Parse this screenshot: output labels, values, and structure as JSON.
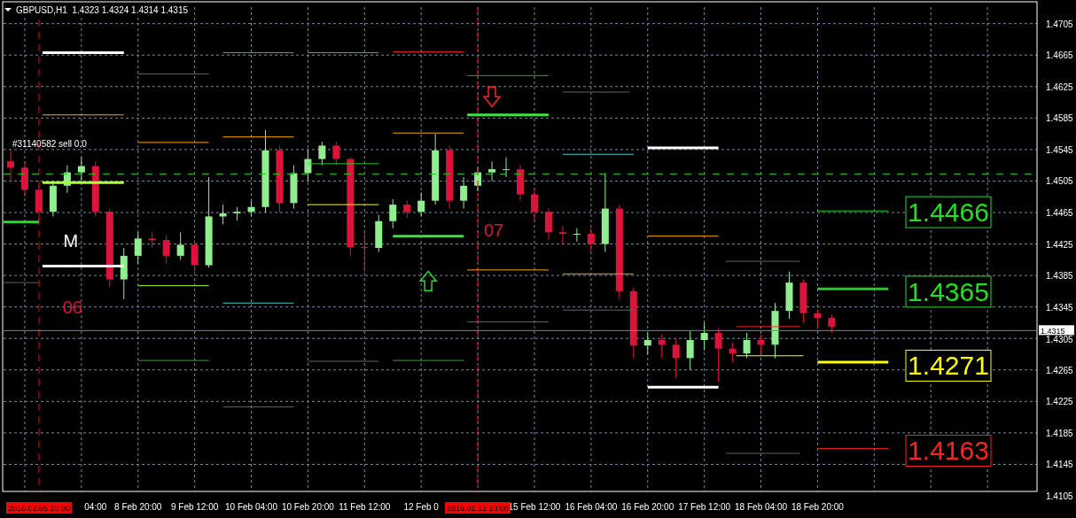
{
  "chart": {
    "title": "GBPUSD,H1",
    "quote": "1.4323 1.4324 1.4314 1.4315",
    "chart_data": {
      "type": "candlestick",
      "grid": true,
      "categories": [
        null,
        null,
        null,
        null,
        null,
        null,
        "04:00",
        null,
        null,
        "8 Feb 20:00",
        null,
        null,
        null,
        "9 Feb 12:00",
        null,
        null,
        null,
        "10 Feb 04:00",
        null,
        null,
        null,
        "10 Feb 20:00",
        null,
        null,
        null,
        "11 Feb 12:00",
        null,
        null,
        null,
        "12 Feb 0",
        null,
        null,
        null,
        null,
        null,
        null,
        null,
        "15 Feb 12:00",
        null,
        null,
        null,
        "16 Feb 04:00",
        null,
        null,
        null,
        "16 Feb 20:00",
        null,
        null,
        null,
        "17 Feb 12:00",
        null,
        null,
        null,
        "18 Feb 04:00",
        null,
        null,
        null,
        "18 Feb 20:00",
        null,
        null,
        null,
        null,
        null,
        null,
        null,
        null,
        null,
        null,
        null,
        null,
        null,
        null,
        null
      ],
      "ohlc": [
        [
          1.453,
          1.4545,
          1.4505,
          1.4522
        ],
        [
          1.4522,
          1.453,
          1.4485,
          1.4494
        ],
        [
          1.4494,
          1.45,
          1.4455,
          1.4466
        ],
        [
          1.4466,
          1.4505,
          1.446,
          1.4499
        ],
        [
          1.4499,
          1.4525,
          1.449,
          1.4516
        ],
        [
          1.4516,
          1.4535,
          1.4505,
          1.4524
        ],
        [
          1.4524,
          1.453,
          1.446,
          1.4466
        ],
        [
          1.4466,
          1.447,
          1.437,
          1.438
        ],
        [
          1.438,
          1.442,
          1.4355,
          1.441
        ],
        [
          1.441,
          1.444,
          1.44,
          1.4432
        ],
        [
          1.4432,
          1.444,
          1.442,
          1.443
        ],
        [
          1.443,
          1.4436,
          1.44,
          1.441
        ],
        [
          1.441,
          1.444,
          1.4405,
          1.4424
        ],
        [
          1.4424,
          1.443,
          1.4385,
          1.4398
        ],
        [
          1.4398,
          1.451,
          1.4395,
          1.446
        ],
        [
          1.446,
          1.4475,
          1.445,
          1.4464
        ],
        [
          1.4464,
          1.4472,
          1.4455,
          1.4466
        ],
        [
          1.4466,
          1.448,
          1.446,
          1.4472
        ],
        [
          1.4472,
          1.457,
          1.4465,
          1.4544
        ],
        [
          1.4544,
          1.455,
          1.4465,
          1.4477
        ],
        [
          1.4477,
          1.4525,
          1.447,
          1.4515
        ],
        [
          1.4515,
          1.4545,
          1.4505,
          1.4533
        ],
        [
          1.4533,
          1.4555,
          1.4525,
          1.455
        ],
        [
          1.455,
          1.4555,
          1.4525,
          1.4533
        ],
        [
          1.4533,
          1.4535,
          1.441,
          1.4421
        ],
        [
          1.4421,
          1.444,
          1.439,
          1.442
        ],
        [
          1.442,
          1.4462,
          1.4415,
          1.4454
        ],
        [
          1.4454,
          1.4482,
          1.4445,
          1.4475
        ],
        [
          1.4475,
          1.448,
          1.4458,
          1.4466
        ],
        [
          1.4466,
          1.449,
          1.446,
          1.448
        ],
        [
          1.448,
          1.4565,
          1.4475,
          1.4544
        ],
        [
          1.4544,
          1.455,
          1.447,
          1.448
        ],
        [
          1.448,
          1.451,
          1.447,
          1.4499
        ],
        [
          1.4499,
          1.4522,
          1.4492,
          1.4516
        ],
        [
          1.4516,
          1.453,
          1.4505,
          1.452
        ],
        [
          1.452,
          1.4535,
          1.451,
          1.452
        ],
        [
          1.452,
          1.4525,
          1.448,
          1.4488
        ],
        [
          1.4488,
          1.4495,
          1.4455,
          1.4466
        ],
        [
          1.4466,
          1.447,
          1.443,
          1.444
        ],
        [
          1.444,
          1.4448,
          1.4425,
          1.4438
        ],
        [
          1.4438,
          1.4445,
          1.4428,
          1.4438
        ],
        [
          1.4438,
          1.4445,
          1.4415,
          1.4425
        ],
        [
          1.4425,
          1.4515,
          1.4415,
          1.447
        ],
        [
          1.447,
          1.4475,
          1.4355,
          1.4365
        ],
        [
          1.4365,
          1.437,
          1.428,
          1.4296
        ],
        [
          1.4296,
          1.4312,
          1.4285,
          1.4303
        ],
        [
          1.4303,
          1.431,
          1.428,
          1.4297
        ],
        [
          1.4297,
          1.4305,
          1.4255,
          1.428
        ],
        [
          1.428,
          1.4315,
          1.4265,
          1.4303
        ],
        [
          1.4303,
          1.4325,
          1.429,
          1.4312
        ],
        [
          1.4312,
          1.4318,
          1.425,
          1.4292
        ],
        [
          1.4292,
          1.43,
          1.4275,
          1.4286
        ],
        [
          1.4286,
          1.4312,
          1.428,
          1.4303
        ],
        [
          1.4303,
          1.431,
          1.4285,
          1.4297
        ],
        [
          1.4297,
          1.435,
          1.428,
          1.434
        ],
        [
          1.434,
          1.439,
          1.433,
          1.4376
        ],
        [
          1.4376,
          1.438,
          1.4325,
          1.4337
        ],
        [
          1.4337,
          1.4342,
          1.432,
          1.4331
        ],
        [
          1.4331,
          1.4335,
          1.4312,
          1.432
        ],
        null,
        null,
        null,
        null,
        null,
        null,
        null,
        null,
        null,
        null,
        null,
        null,
        null,
        null
      ],
      "ylim": [
        1.4105,
        1.4726
      ],
      "yticks": [
        {
          "value": 1.4705,
          "label": "1.4705"
        },
        {
          "value": 1.4665,
          "label": "1.4665"
        },
        {
          "value": 1.4625,
          "label": "1.4625"
        },
        {
          "value": 1.4585,
          "label": "1.4585"
        },
        {
          "value": 1.4545,
          "label": "1.4545"
        },
        {
          "value": 1.4505,
          "label": "1.4505"
        },
        {
          "value": 1.4465,
          "label": "1.4465"
        },
        {
          "value": 1.4425,
          "label": "1.4425"
        },
        {
          "value": 1.4385,
          "label": "1.4385"
        },
        {
          "value": 1.4345,
          "label": "1.4345"
        },
        {
          "value": 1.4305,
          "label": "1.4305"
        },
        {
          "value": 1.4265,
          "label": "1.4265"
        },
        {
          "value": 1.4225,
          "label": "1.4225"
        },
        {
          "value": 1.4185,
          "label": "1.4185"
        },
        {
          "value": 1.4145,
          "label": "1.4145"
        },
        {
          "value": 1.4105,
          "label": "1.4105"
        }
      ]
    },
    "trade_label": "#31140582 sell 0.0",
    "current_price": "1.4315",
    "texts": [
      {
        "label": "M",
        "color": "#ffffff"
      },
      {
        "label": "06",
        "color": "#dc143c"
      },
      {
        "label": "07",
        "color": "#dc143c"
      }
    ],
    "price_tags": [
      {
        "label": "1.4466",
        "color": "#20e020"
      },
      {
        "label": "1.4365",
        "color": "#20e020"
      },
      {
        "label": "1.4271",
        "color": "#ffff00"
      },
      {
        "label": "1.4163",
        "color": "#ff2020"
      }
    ],
    "separators": [
      {
        "label": "2016.02.05 23:00"
      },
      {
        "label": "2016.02.12 23:00"
      }
    ]
  }
}
